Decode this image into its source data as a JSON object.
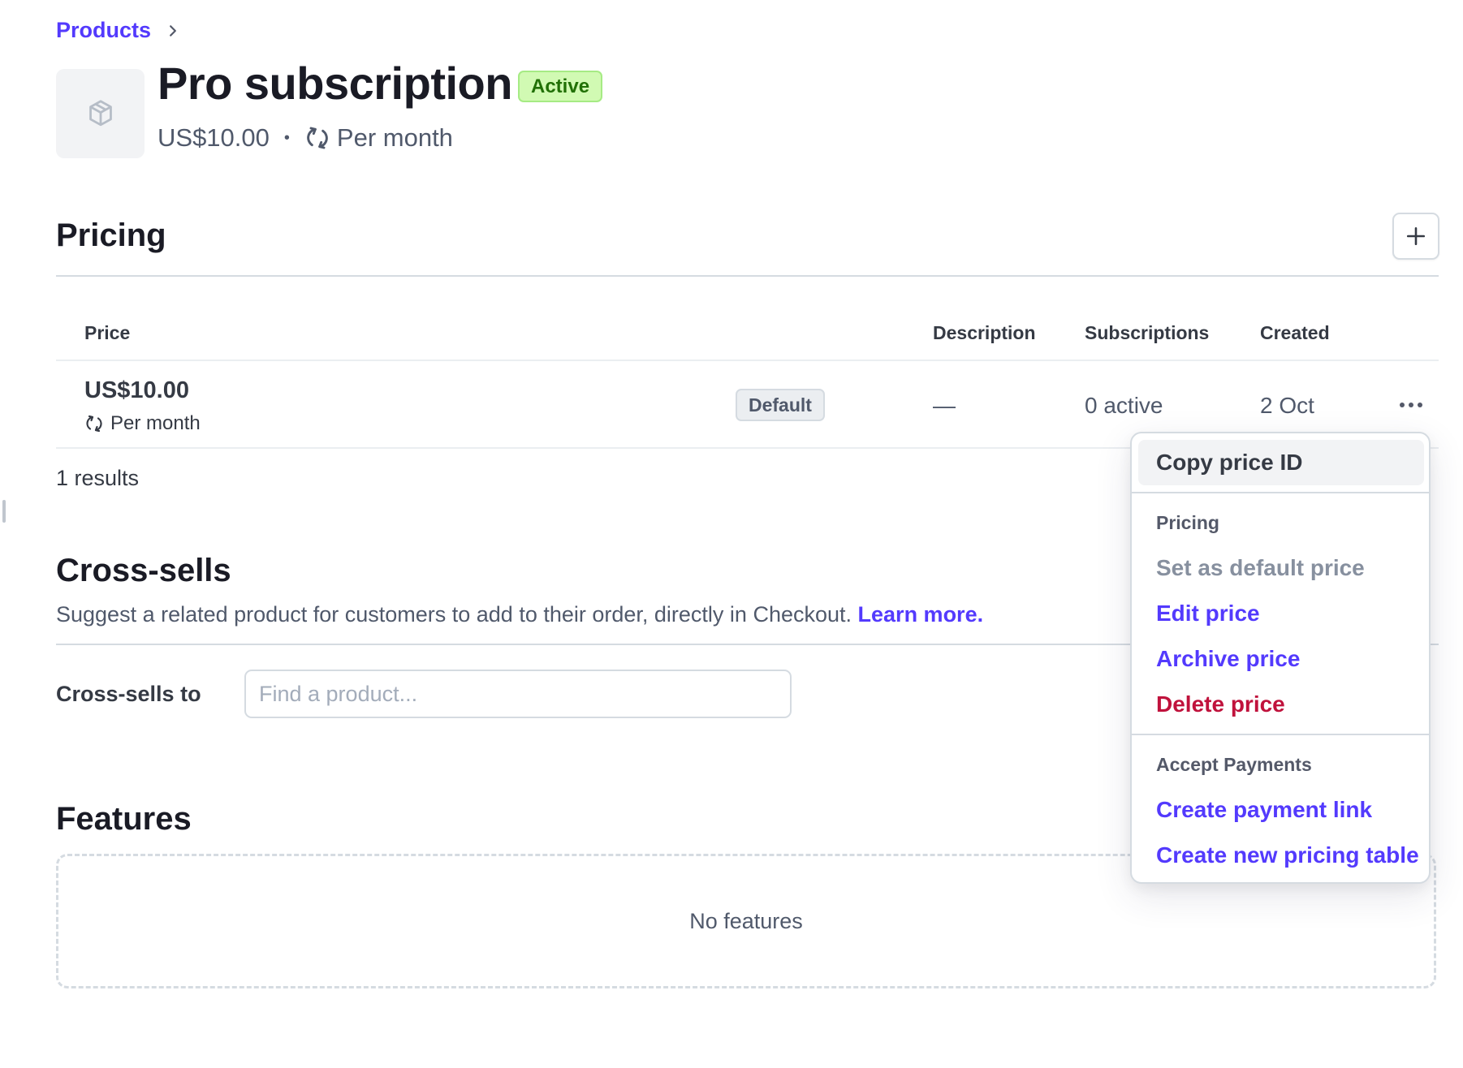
{
  "breadcrumb": {
    "items": [
      {
        "label": "Products"
      }
    ]
  },
  "product": {
    "title": "Pro subscription",
    "status": "Active",
    "price": "US$10.00",
    "separator": "•",
    "interval": "Per month",
    "icon": "box-icon"
  },
  "pricing": {
    "heading": "Pricing",
    "add_button_icon": "plus-icon",
    "columns": [
      "Price",
      "Description",
      "Subscriptions",
      "Created"
    ],
    "rows": [
      {
        "price": "US$10.00",
        "interval": "Per month",
        "badge": "Default",
        "description": "—",
        "subscriptions": "0 active",
        "created": "2 Oct"
      }
    ],
    "results": "1 results"
  },
  "cross_sells": {
    "heading": "Cross-sells",
    "description": "Suggest a related product for customers to add to their order, directly in Checkout.",
    "learn_more": "Learn more.",
    "field_label": "Cross-sells to",
    "input_value": "",
    "input_placeholder": "Find a product..."
  },
  "features": {
    "heading": "Features",
    "empty_text": "No features"
  },
  "context_menu": {
    "copy_id": "Copy price ID",
    "group_pricing": "Pricing",
    "set_default": "Set as default price",
    "edit": "Edit price",
    "archive": "Archive price",
    "delete": "Delete price",
    "group_payments": "Accept Payments",
    "payment_link": "Create payment link",
    "pricing_table": "Create new pricing table"
  },
  "colors": {
    "accent": "#533afd",
    "danger": "#c0123c",
    "active_badge_bg": "#d1fab3",
    "active_badge_text": "#217005"
  }
}
